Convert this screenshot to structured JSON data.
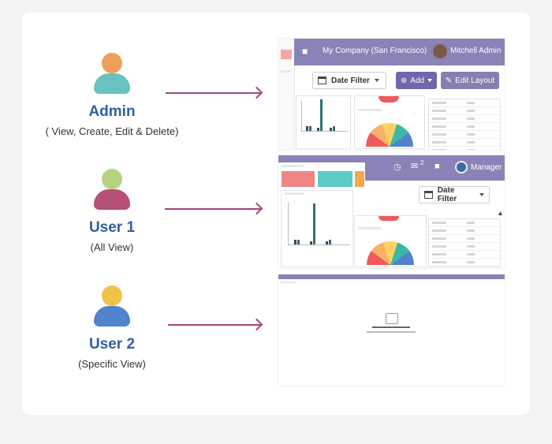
{
  "roles": [
    {
      "name": "Admin",
      "desc": "( View, Create, Edit & Delete)",
      "colors": {
        "head": "#ee9f5c",
        "body": "#68c2bf"
      }
    },
    {
      "name": "User 1",
      "desc": "(All View)",
      "colors": {
        "head": "#b6d17f",
        "body": "#b54f76"
      }
    },
    {
      "name": "User 2",
      "desc": "(Specific View)",
      "colors": {
        "head": "#f0c24b",
        "body": "#4f83cc"
      }
    }
  ],
  "admin_screen": {
    "company": "My Company (San Francisco)",
    "user": "Mitchell Admin",
    "date_filter": "Date Filter",
    "add": "Add",
    "edit_layout": "Edit Layout"
  },
  "user1_screen": {
    "notif_count": "2",
    "user": "Manager",
    "date_filter": "Date Filter"
  },
  "user2_screen": {},
  "colors": {
    "topbar": "#8a83b8",
    "arrow": "#a0457a",
    "name": "#2f5fa7",
    "add_btn": "#6f67a8"
  }
}
